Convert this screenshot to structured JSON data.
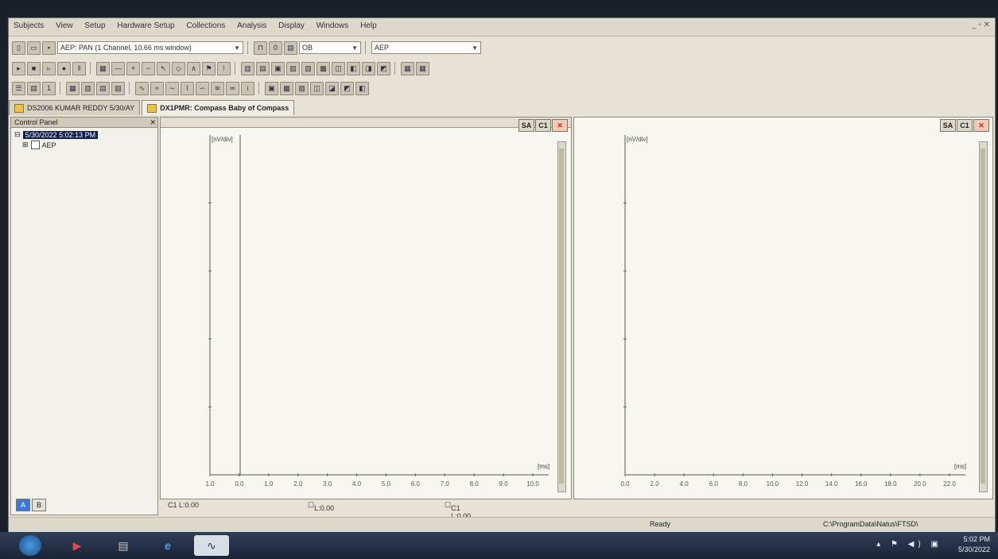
{
  "menu": [
    "Subjects",
    "View",
    "Setup",
    "Hardware Setup",
    "Collections",
    "Analysis",
    "Display",
    "Windows",
    "Help"
  ],
  "toolbar": {
    "protocol_combo": "AEP: PAN (1 Channel, 10.66 ms window)",
    "channel_combo": "OB",
    "mode_combo": "AEP"
  },
  "doc_tabs": [
    {
      "label": "DS2006 KUMAR REDDY 5/30/AY",
      "active": false
    },
    {
      "label": "DX1PMR: Compass Baby of Compass",
      "active": true
    }
  ],
  "control_panel": {
    "title": "Control Panel",
    "tree": [
      {
        "label": "5/30/2022 5:02:13 PM",
        "selected": true
      },
      {
        "label": "AEP",
        "selected": false
      }
    ],
    "bottom_buttons": [
      "A",
      "B"
    ]
  },
  "chart_buttons": [
    "SA",
    "C1"
  ],
  "charts": [
    {
      "ylabel": "[nV/div]",
      "xlabel": "[ms]",
      "tick_labels": [
        "1.0",
        "0.0",
        "1.0",
        "2.0",
        "3.0",
        "4.0",
        "5.0",
        "6.0",
        "7.0",
        "8.0",
        "9.0",
        "10.0"
      ]
    },
    {
      "ylabel": "[nV/div]",
      "xlabel": "[ms]",
      "tick_labels": [
        "0.0",
        "2.0",
        "4.0",
        "6.0",
        "8.0",
        "10.0",
        "12.0",
        "14.0",
        "16.0",
        "18.0",
        "20.0",
        "22.0"
      ]
    }
  ],
  "chart_status": {
    "c1": "C1 L:0.00",
    "l": "L:0.00",
    "cl": "C1 L:0.00"
  },
  "statusbar": {
    "ready": "Ready",
    "path": "C:\\ProgramData\\Natus\\FTSD\\"
  },
  "taskbar": {
    "time": "5:02 PM",
    "date": "5/30/2022"
  },
  "chart_data": [
    {
      "type": "line",
      "xlabel": "[ms]",
      "ylabel": "[nV/div]",
      "x_ticks": [
        "1.0",
        "0.0",
        "1.0",
        "2.0",
        "3.0",
        "4.0",
        "5.0",
        "6.0",
        "7.0",
        "8.0",
        "9.0",
        "10.0"
      ],
      "series": []
    },
    {
      "type": "line",
      "xlabel": "[ms]",
      "ylabel": "[nV/div]",
      "x_ticks": [
        "0.0",
        "2.0",
        "4.0",
        "6.0",
        "8.0",
        "10.0",
        "12.0",
        "14.0",
        "16.0",
        "18.0",
        "20.0",
        "22.0"
      ],
      "series": []
    }
  ]
}
